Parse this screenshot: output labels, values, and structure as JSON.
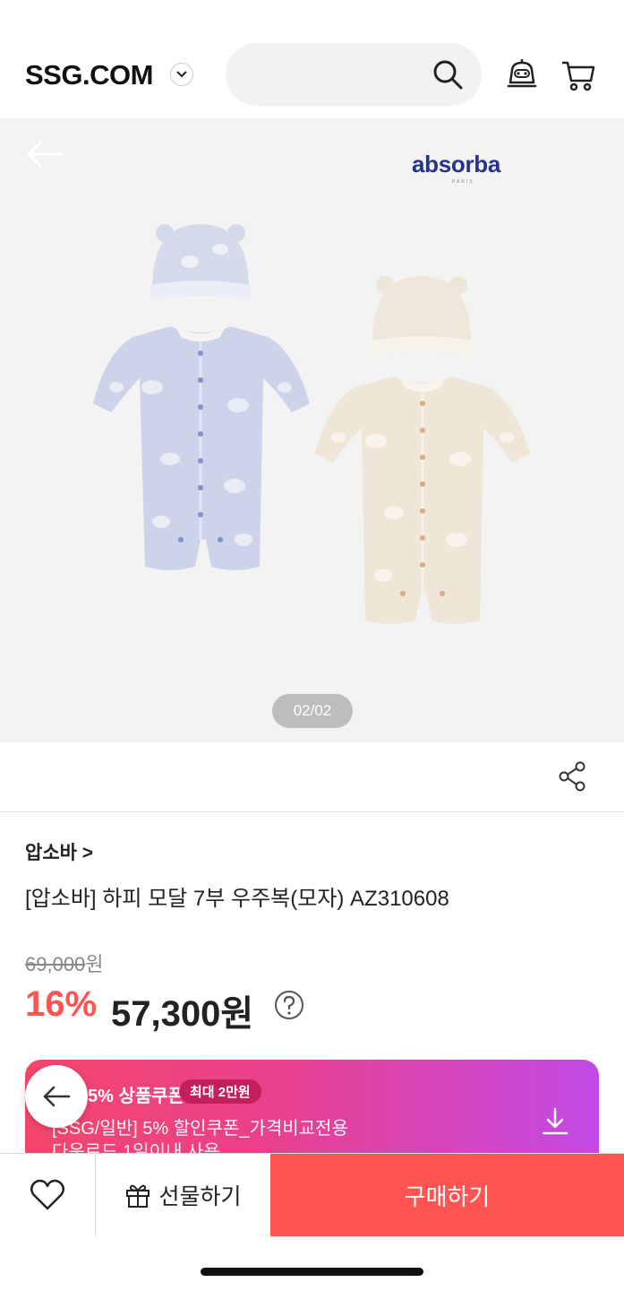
{
  "header": {
    "logo": "SSG.COM",
    "search_placeholder": ""
  },
  "gallery": {
    "brand_logo": "absorba",
    "brand_sub": "PARIS",
    "pager": "02/02"
  },
  "product": {
    "brand": "압소바 >",
    "title": "[압소바] 하피 모달 7부 우주복(모자) AZ310608",
    "original_price": "69,000",
    "original_unit": "원",
    "discount": "16%",
    "price": "57,300원"
  },
  "coupon": {
    "title": "5% 상품쿠폰",
    "badge": "최대 2만원",
    "desc": "[SSG/일반] 5% 할인쿠폰_가격비교전용",
    "desc2": "다운로드 1일이내 사용"
  },
  "bottom_bar": {
    "gift_label": "선물하기",
    "buy_label": "구매하기"
  },
  "colors": {
    "accent": "#ff5452",
    "brand_blue": "#27338a"
  }
}
